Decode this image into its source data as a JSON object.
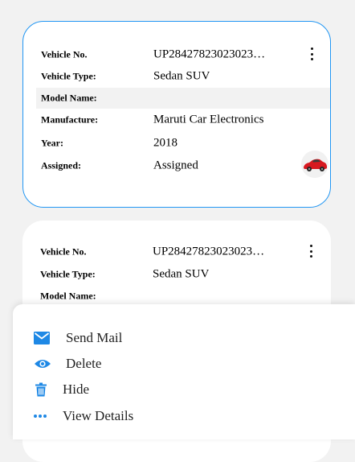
{
  "cards": [
    {
      "rows": [
        {
          "label": "Vehicle No.",
          "value": "UP28427823023023…"
        },
        {
          "label": "Vehicle Type:",
          "value": "Sedan SUV"
        },
        {
          "label": "Model Name:",
          "value": ""
        },
        {
          "label": "Manufacture:",
          "value": "Maruti Car Electronics"
        },
        {
          "label": "Year:",
          "value": "2018"
        },
        {
          "label": "Assigned:",
          "value": "Assigned"
        }
      ]
    },
    {
      "rows": [
        {
          "label": "Vehicle No.",
          "value": "UP28427823023023…"
        },
        {
          "label": "Vehicle Type:",
          "value": "Sedan SUV"
        },
        {
          "label": "Model Name:",
          "value": ""
        }
      ]
    }
  ],
  "menu": {
    "items": [
      {
        "label": "Send Mail",
        "icon": "mail-icon"
      },
      {
        "label": "Delete",
        "icon": "eye-icon"
      },
      {
        "label": "Hide",
        "icon": "trash-icon"
      },
      {
        "label": "View Details",
        "icon": "more-horizontal-icon"
      }
    ],
    "icon_color": "#1e88e5"
  },
  "colors": {
    "selected_border": "#2196f3",
    "background": "#f2f2f2"
  }
}
